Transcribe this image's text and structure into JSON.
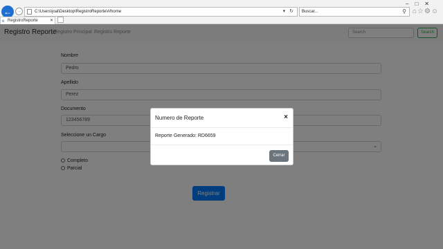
{
  "browser": {
    "address": "C:\\Users\\joal\\Desktop\\RegistroReporte\\#/home",
    "search_placeholder": "Buscar...",
    "tab_title": "RegistroReporte",
    "back_icon": "arrow-left-icon"
  },
  "navbar": {
    "brand": "Registro Reporte",
    "links": [
      "Registro Principal",
      "Registro Reporte"
    ],
    "search_placeholder": "Search",
    "search_button": "Search"
  },
  "form": {
    "nombre_label": "Nombre",
    "nombre_value": "Pedro",
    "apellido_label": "Apellido",
    "apellido_value": "Perez",
    "documento_label": "Documento",
    "documento_value": "123456789",
    "cargo_label": "Seleccione un Cargo",
    "cargo_value": "",
    "radios": [
      "Completo",
      "Parcial"
    ],
    "submit": "Registrar"
  },
  "modal": {
    "title": "Numero de Reporte",
    "close_symbol": "×",
    "body": "Reporte Generado: RD6659",
    "button": "Cerrar"
  },
  "colors": {
    "primary": "#007bff",
    "secondary": "#6c757d",
    "success": "#28a745"
  }
}
